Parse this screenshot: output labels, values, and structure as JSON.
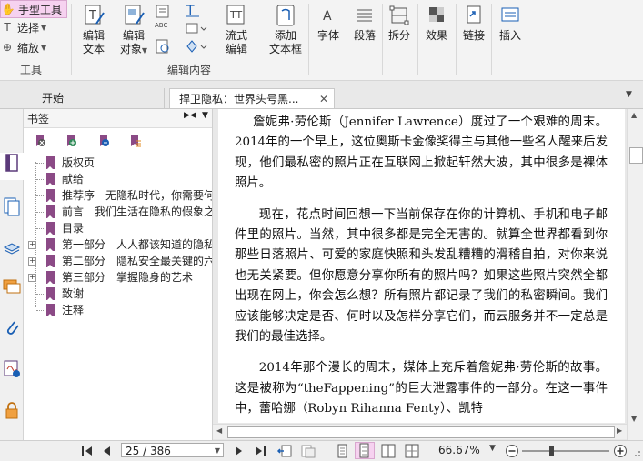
{
  "toolbar": {
    "hand_tool": "手型工具",
    "select": "选择",
    "zoom": "缩放",
    "tools_group": "工具",
    "edit_text_l1": "编辑",
    "edit_text_l2": "文本",
    "edit_object_l1": "编辑",
    "edit_object_l2": "对象",
    "flow_edit_l1": "流式",
    "flow_edit_l2": "编辑",
    "add_textbox_l1": "添加",
    "add_textbox_l2": "文本框",
    "edit_content_group": "编辑内容",
    "font": "字体",
    "paragraph": "段落",
    "split": "拆分",
    "effects": "效果",
    "link": "链接",
    "insert": "插入",
    "abc": "ABC"
  },
  "tabs": [
    {
      "label": "开始"
    },
    {
      "label": "捍卫隐私：世界头号黑..."
    }
  ],
  "bookmarks": {
    "title": "书签",
    "items": [
      {
        "label": "版权页",
        "expandable": false
      },
      {
        "label": "献给",
        "expandable": false
      },
      {
        "label": "推荐序　无隐私时代，你需要何",
        "expandable": false
      },
      {
        "label": "前言　我们生活在隐私的假象之",
        "expandable": false
      },
      {
        "label": "目录",
        "expandable": false
      },
      {
        "label": "第一部分　人人都该知道的隐私",
        "expandable": true
      },
      {
        "label": "第二部分　隐私安全最关键的六",
        "expandable": true
      },
      {
        "label": "第三部分　掌握隐身的艺术",
        "expandable": true
      },
      {
        "label": "致谢",
        "expandable": false
      },
      {
        "label": "注释",
        "expandable": false
      }
    ]
  },
  "document": {
    "paragraphs": [
      "詹妮弗·劳伦斯（Jennifer Lawrence）度过了一个艰难的周末。2014年的一个早上，这位奥斯卡金像奖得主与其他一些名人醒来后发现，他们最私密的照片正在互联网上掀起轩然大波，其中很多是裸体照片。",
      "现在，花点时间回想一下当前保存在你的计算机、手机和电子邮件里的照片。当然，其中很多都是完全无害的。就算全世界都看到你那些日落照片、可爱的家庭快照和头发乱糟糟的滑稽自拍，对你来说也无关紧要。但你愿意分享你所有的照片吗？如果这些照片突然全都出现在网上，你会怎么想？所有照片都记录了我们的私密瞬间。我们应该能够决定是否、何时以及怎样分享它们，而云服务并不一定总是我们的最佳选择。",
      "2014年那个漫长的周末，媒体上充斥着詹妮弗·劳伦斯的故事。这是被称为“theFappening”的巨大泄露事件的一部分。在这一事件中，蕾哈娜（Robyn Rihanna Fenty）、凯特"
    ]
  },
  "status": {
    "page_value": "25 / 386",
    "zoom": "66.67%"
  },
  "colors": {
    "accent": "#8b4a86",
    "ribbon_bg": "#f3f3f3",
    "hand_tool_bg": "#f6d2f0"
  }
}
